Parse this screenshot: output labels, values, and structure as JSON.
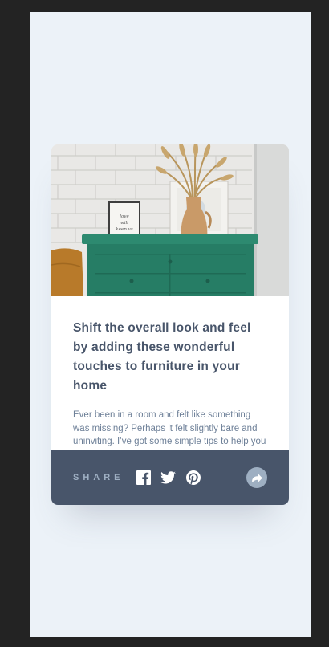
{
  "article": {
    "title": "Shift the overall look and feel by adding these wonderful touches to furniture in your home",
    "excerpt": "Ever been in a room and felt like something was missing? Perhaps it felt slightly bare and uninviting. I’ve got some simple tips to help you make any room feel complete.",
    "image": "drawers-photo"
  },
  "share": {
    "label": "SHARE",
    "icons": [
      "facebook-icon",
      "twitter-icon",
      "pinterest-icon",
      "share-icon"
    ]
  },
  "colors": {
    "page_background": "#ecf2f8",
    "card": "#ffffff",
    "share_bar": "#48556a",
    "title": "#48556a",
    "text": "#6e8098",
    "accent": "#9eafc2"
  }
}
